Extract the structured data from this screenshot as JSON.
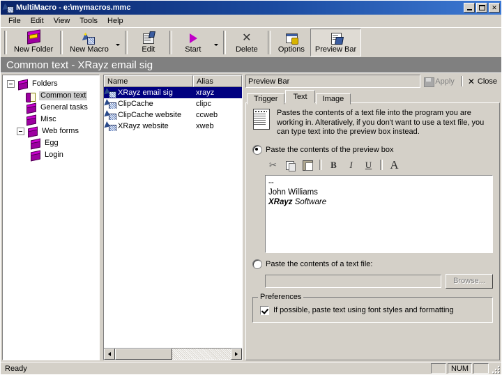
{
  "window": {
    "title": "MultiMacro - e:\\mymacros.mmc",
    "icon": "macro-app-icon",
    "buttons": {
      "minimize": "_",
      "maximize": "□",
      "close": "✕"
    }
  },
  "menu": {
    "items": [
      "File",
      "Edit",
      "View",
      "Tools",
      "Help"
    ]
  },
  "toolbar": {
    "buttons": [
      {
        "label": "New Folder",
        "icon": "new-folder-icon",
        "dropdown": false,
        "pressed": false
      },
      {
        "label": "New Macro",
        "icon": "new-macro-icon",
        "dropdown": true,
        "pressed": false
      },
      {
        "label": "Edit",
        "icon": "edit-icon",
        "dropdown": false,
        "pressed": false
      },
      {
        "label": "Start",
        "icon": "start-play-icon",
        "dropdown": true,
        "pressed": false
      },
      {
        "label": "Delete",
        "icon": "delete-x-icon",
        "dropdown": false,
        "pressed": false
      },
      {
        "label": "Options",
        "icon": "options-icon",
        "dropdown": false,
        "pressed": false
      },
      {
        "label": "Preview Bar",
        "icon": "preview-bar-icon",
        "dropdown": false,
        "pressed": true
      }
    ]
  },
  "banner": {
    "title": "Common text - XRayz email sig"
  },
  "tree": {
    "nodes": [
      {
        "label": "Folders",
        "icon": "books-icon",
        "level": 0,
        "expander": "minus",
        "selected": false
      },
      {
        "label": "Common text",
        "icon": "open-book-icon",
        "level": 1,
        "expander": "none",
        "selected": true
      },
      {
        "label": "General tasks",
        "icon": "books-icon",
        "level": 1,
        "expander": "none",
        "selected": false
      },
      {
        "label": "Misc",
        "icon": "books-icon",
        "level": 1,
        "expander": "none",
        "selected": false
      },
      {
        "label": "Web forms",
        "icon": "books-icon",
        "level": 1,
        "expander": "minus",
        "selected": false
      },
      {
        "label": "Egg",
        "icon": "books-icon",
        "level": 2,
        "expander": "none",
        "selected": false
      },
      {
        "label": "Login",
        "icon": "books-icon",
        "level": 2,
        "expander": "none",
        "selected": false
      }
    ]
  },
  "list": {
    "columns": [
      "Name",
      "Alias"
    ],
    "rows": [
      {
        "name": "XRayz email sig",
        "alias": "xrayz",
        "icon": "macro-icon",
        "selected": true
      },
      {
        "name": "ClipCache",
        "alias": "clipc",
        "icon": "macro-icon",
        "selected": false
      },
      {
        "name": "ClipCache website",
        "alias": "ccweb",
        "icon": "macro-icon",
        "selected": false
      },
      {
        "name": "XRayz website",
        "alias": "xweb",
        "icon": "macro-icon",
        "selected": false
      }
    ],
    "hscrollbar": {
      "left_arrow": "◄",
      "right_arrow": "►"
    }
  },
  "preview_bar": {
    "field_value": "Preview Bar",
    "apply_label": "Apply",
    "apply_enabled": false,
    "close_label": "Close",
    "tabs": [
      {
        "label": "Trigger",
        "active": false
      },
      {
        "label": "Text",
        "active": true
      },
      {
        "label": "Image",
        "active": false
      }
    ],
    "description": "Pastes the contents of a text file into the program you are working in. Alteratively, if you don't want to use a text file, you can type text into the preview box instead.",
    "option_preview": {
      "label": "Paste the contents of the preview box",
      "selected": true
    },
    "option_file": {
      "label": "Paste the contents of a text file:",
      "selected": false
    },
    "format_toolbar": [
      {
        "name": "cut-icon",
        "glyph": "✂"
      },
      {
        "name": "copy-icon",
        "glyph": ""
      },
      {
        "name": "paste-icon",
        "glyph": ""
      },
      {
        "name": "bold-icon",
        "glyph": "B"
      },
      {
        "name": "italic-icon",
        "glyph": "I"
      },
      {
        "name": "underline-icon",
        "glyph": "U"
      },
      {
        "name": "font-icon",
        "glyph": "A"
      }
    ],
    "preview_text": {
      "line1": "--",
      "line2": "John Williams",
      "line3_bold": "XRayz",
      "line3_italic": " Software"
    },
    "file_path": "",
    "browse_label": "Browse...",
    "preferences": {
      "title": "Preferences",
      "checkbox_label": "If possible, paste text using font styles and formatting",
      "checked": true
    }
  },
  "status": {
    "message": "Ready",
    "num_lock": "NUM"
  },
  "colors": {
    "face": "#d4d0c8",
    "title_start": "#0a246a",
    "title_end": "#3e7ad4",
    "selection": "#000080",
    "banner": "#808080",
    "accent_purple": "#9c00a0"
  }
}
